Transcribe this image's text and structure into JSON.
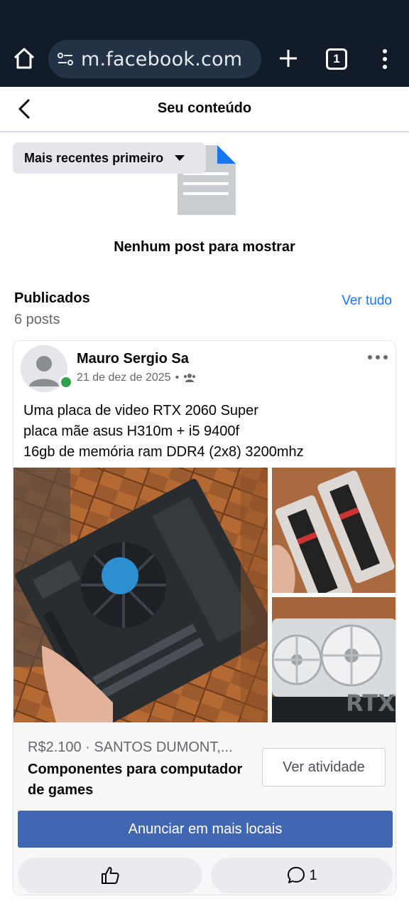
{
  "browser": {
    "url": "m.facebook.com",
    "tab_count": "1"
  },
  "header": {
    "title": "Seu conteúdo"
  },
  "sort": {
    "label": "Mais recentes primeiro"
  },
  "empty_state": {
    "text": "Nenhum post para mostrar"
  },
  "published": {
    "title": "Publicados",
    "count": "6 posts",
    "see_all": "Ver tudo"
  },
  "post": {
    "author": "Mauro Sergio Sa",
    "date": "21 de dez de 2025",
    "separator": "•",
    "text_lines": [
      "Uma placa de video RTX 2060 Super",
      "placa mãe asus H310m + i5 9400f",
      "16gb de memória ram DDR4 (2x8) 3200mhz"
    ],
    "gpu_brand_text": "RTX",
    "listing": {
      "price_location": "R$2.100 · SANTOS DUMONT,...",
      "product_title": "Componentes para computador de games",
      "activity_button": "Ver atividade",
      "promote_button": "Anunciar em mais locais"
    },
    "comment_count": "1"
  },
  "colors": {
    "chrome_bg": "#121b28",
    "link_blue": "#1877f2",
    "promote_blue": "#4267b2",
    "online_green": "#31a24c"
  }
}
